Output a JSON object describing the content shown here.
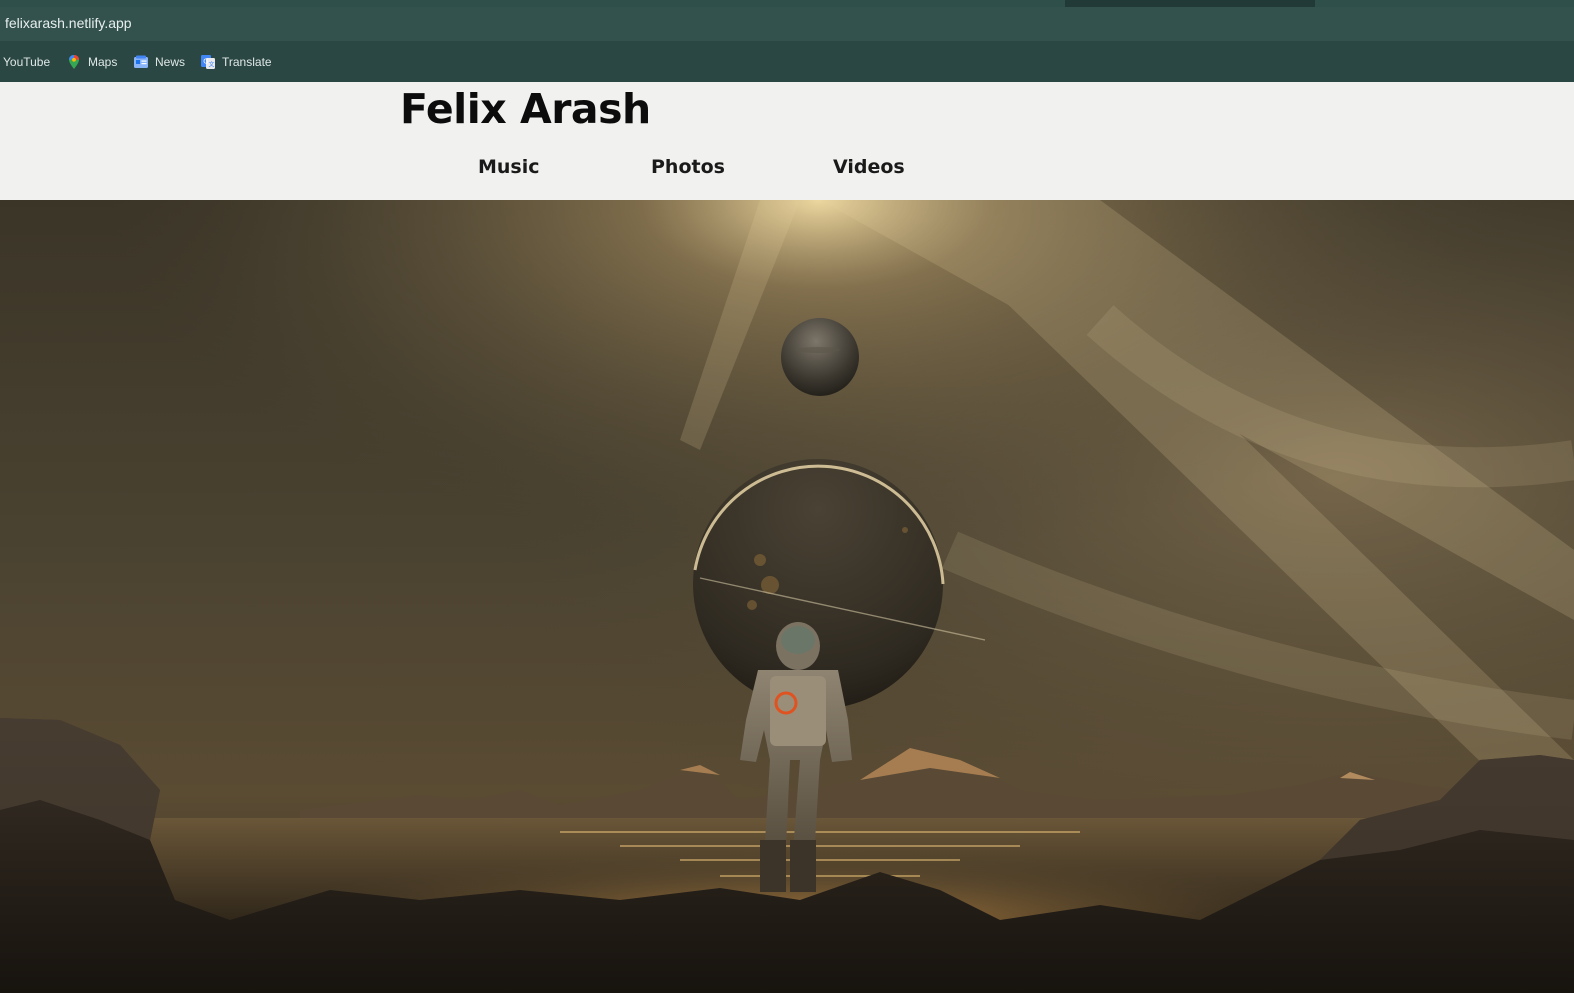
{
  "browser": {
    "url": "felixarash.netlify.app",
    "bookmarks": [
      {
        "label": "YouTube",
        "icon": "youtube-icon"
      },
      {
        "label": "Maps",
        "icon": "maps-pin-icon"
      },
      {
        "label": "News",
        "icon": "news-icon"
      },
      {
        "label": "Translate",
        "icon": "translate-icon"
      }
    ]
  },
  "site": {
    "title": "Felix Arash",
    "nav": [
      {
        "label": "Music"
      },
      {
        "label": "Photos"
      },
      {
        "label": "Videos"
      }
    ]
  },
  "hero": {
    "image_subject": "astronaut-standing-on-rocky-shore-facing-two-planets",
    "colors": {
      "sky": "#4a4232",
      "glow": "#f4d59a",
      "accent_ring": "#e0521f",
      "header_bg": "#f1f1ef",
      "browser_bg": "#2c4a46"
    }
  }
}
